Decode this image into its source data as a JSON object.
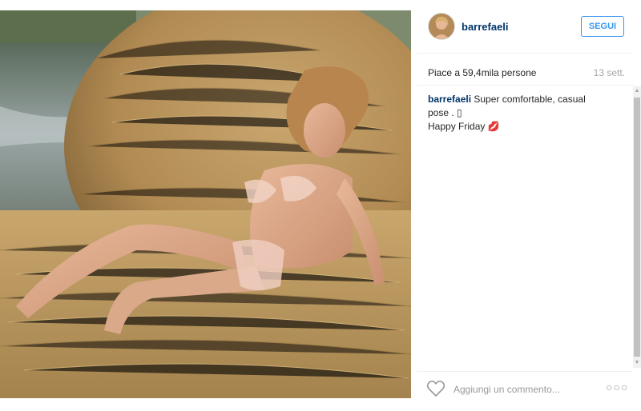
{
  "post": {
    "image_icon": "photo-hay-bale"
  },
  "header": {
    "username": "barrefaeli",
    "follow_label": "SEGUI",
    "avatar_icon": "avatar-profile"
  },
  "stats": {
    "likes_text": "Piace a 59,4mila persone",
    "date_text": "13 sett."
  },
  "caption": {
    "username": "barrefaeli",
    "text_line1": " Super comfortable, casual",
    "text_line2": "pose . ▯",
    "text_line3": "Happy Friday 💋"
  },
  "footer": {
    "like_icon": "heart-icon",
    "comment_placeholder": "Aggiungi un commento...",
    "more_label": "○○○",
    "more_icon": "more-options-icon"
  },
  "scrollbar": {
    "up_arrow": "▲",
    "down_arrow": "▼"
  },
  "colors": {
    "accent": "#3897f0",
    "username": "#003569",
    "muted": "#a5a7aa"
  }
}
